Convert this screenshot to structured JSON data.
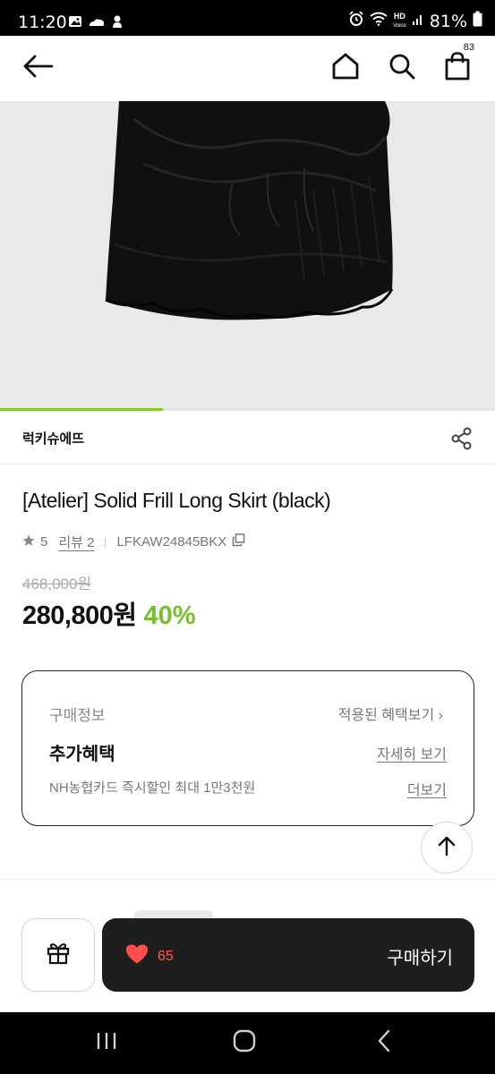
{
  "status_bar": {
    "time": "11:20",
    "battery": "81%",
    "network_label": "HD",
    "network_sub": "Voice",
    "left_icons": [
      "gallery-icon",
      "cloud-weather-icon",
      "notification-app-icon"
    ],
    "right_icons": [
      "alarm-icon",
      "wifi-icon",
      "signal-icon",
      "battery-icon"
    ]
  },
  "header": {
    "back_icon": "arrow-left-icon",
    "home_icon": "home-icon",
    "search_icon": "search-icon",
    "cart_icon": "shopping-bag-icon",
    "cart_count": "83"
  },
  "gallery": {
    "progress": 0.33,
    "accent": "#84cc2b"
  },
  "product": {
    "brand": "럭키슈에뜨",
    "title": "[Atelier] Solid Frill Long Skirt (black)",
    "rating": "5",
    "review_label": "리뷰 2",
    "sku": "LFKAW24845BKX",
    "original_price": "468,000원",
    "price": "280,800원",
    "discount": "40%"
  },
  "purchase_info": {
    "section_label": "구매정보",
    "applied_benefits_link": "적용된 혜택보기 ›",
    "extra_benefit_label": "추가혜택",
    "details_link": "자세히 보기",
    "card_promo": "NH농협카드 즉시할인 최대 1만3천원",
    "more_link": "더보기"
  },
  "bottom_bar": {
    "like_count": "65",
    "buy_label": "구매하기",
    "like_color": "#ff4d4d"
  },
  "colors": {
    "accent_green": "#74c22b",
    "dark_button": "#1e1e1e"
  }
}
